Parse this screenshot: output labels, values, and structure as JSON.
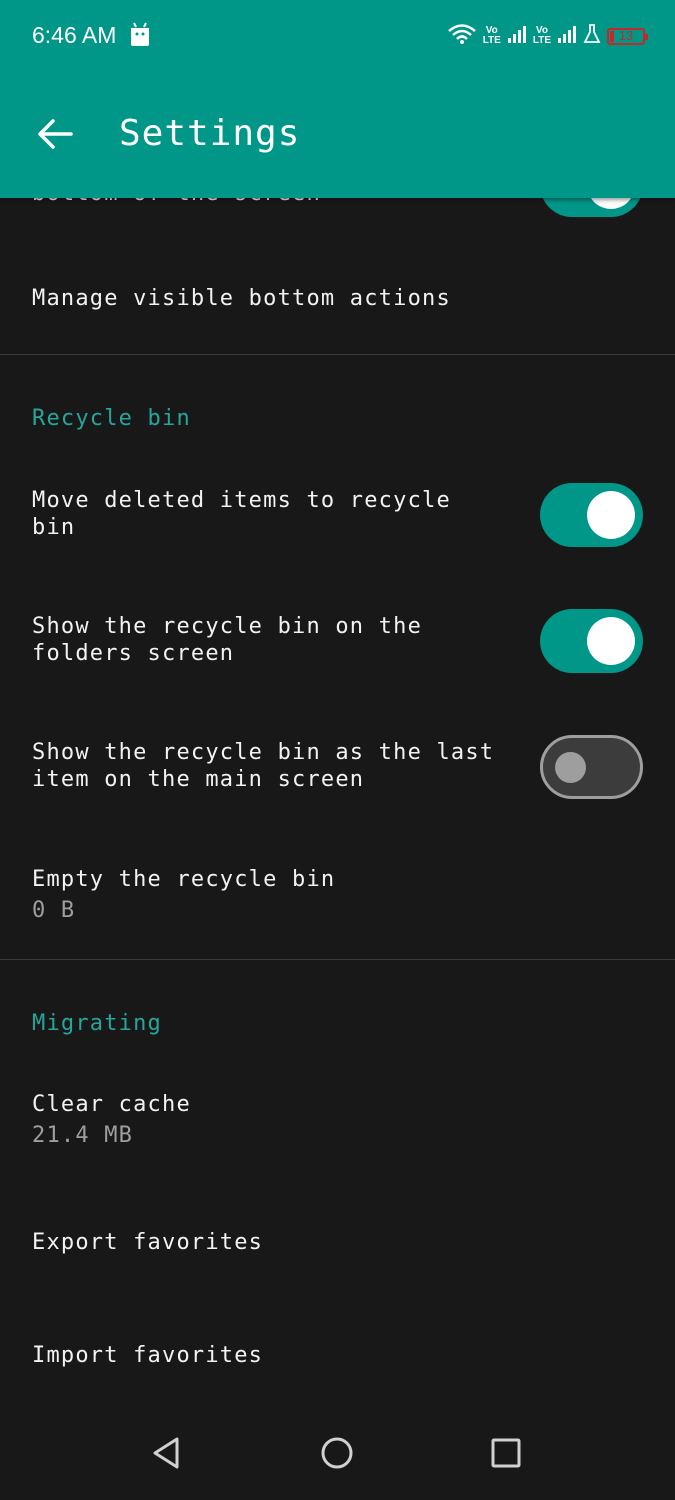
{
  "status_bar": {
    "time": "6:46 AM",
    "lte1": "Vo\nLTE",
    "lte2": "Vo\nLTE",
    "battery": "13"
  },
  "app_bar": {
    "title": "Settings"
  },
  "rows": {
    "partial_prev": {
      "title": "bottom of the screen"
    },
    "manage_bottom_actions": {
      "title": "Manage visible bottom actions"
    },
    "section_recycle": "Recycle bin",
    "move_deleted": {
      "title": "Move deleted items to recycle\nbin",
      "enabled": true
    },
    "show_on_folders": {
      "title": "Show the recycle bin on the\nfolders screen",
      "enabled": true
    },
    "show_last_item": {
      "title": "Show the recycle bin as the last\nitem on the main screen",
      "enabled": false
    },
    "empty_bin": {
      "title": "Empty the recycle bin",
      "sub": "0 B"
    },
    "section_migrating": "Migrating",
    "clear_cache": {
      "title": "Clear cache",
      "sub": "21.4 MB"
    },
    "export_favorites": {
      "title": "Export favorites"
    },
    "import_favorites": {
      "title": "Import favorites"
    }
  },
  "colors": {
    "accent": "#009688",
    "section": "#26a69a",
    "background": "#181818"
  },
  "icons": {
    "back": "arrow-left-icon",
    "nav_back": "triangle-back-icon",
    "nav_home": "circle-home-icon",
    "nav_recents": "square-recents-icon"
  }
}
